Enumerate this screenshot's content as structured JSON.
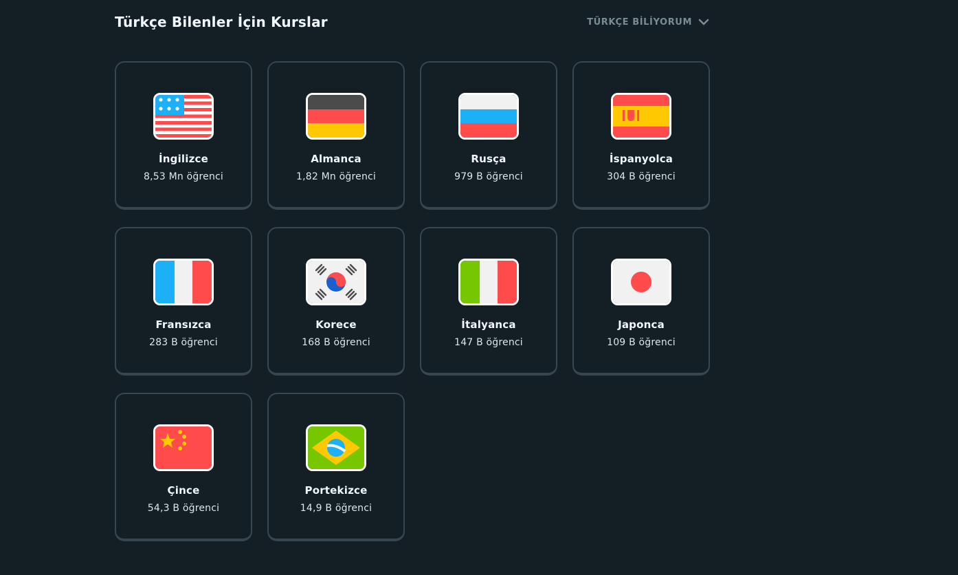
{
  "header": {
    "title": "Türkçe Bilenler İçin Kurslar",
    "language_select_label": "TÜRKÇE BİLİYORUM",
    "language_select_icon": "chevron-down-icon"
  },
  "courses": [
    {
      "name": "İngilizce",
      "learners": "8,53 Mn öğrenci",
      "flag": "us-flag-icon"
    },
    {
      "name": "Almanca",
      "learners": "1,82 Mn öğrenci",
      "flag": "germany-flag-icon"
    },
    {
      "name": "Rusça",
      "learners": "979 B öğrenci",
      "flag": "russia-flag-icon"
    },
    {
      "name": "İspanyolca",
      "learners": "304 B öğrenci",
      "flag": "spain-flag-icon"
    },
    {
      "name": "Fransızca",
      "learners": "283 B öğrenci",
      "flag": "france-flag-icon"
    },
    {
      "name": "Korece",
      "learners": "168 B öğrenci",
      "flag": "korea-flag-icon"
    },
    {
      "name": "İtalyanca",
      "learners": "147 B öğrenci",
      "flag": "italy-flag-icon"
    },
    {
      "name": "Japonca",
      "learners": "109 B öğrenci",
      "flag": "japan-flag-icon"
    },
    {
      "name": "Çince",
      "learners": "54,3 B öğrenci",
      "flag": "china-flag-icon"
    },
    {
      "name": "Portekizce",
      "learners": "14,9 B öğrenci",
      "flag": "brazil-flag-icon"
    }
  ],
  "colors": {
    "background": "#131f24",
    "card_border": "#37464f",
    "text_muted": "#7a8b93"
  }
}
